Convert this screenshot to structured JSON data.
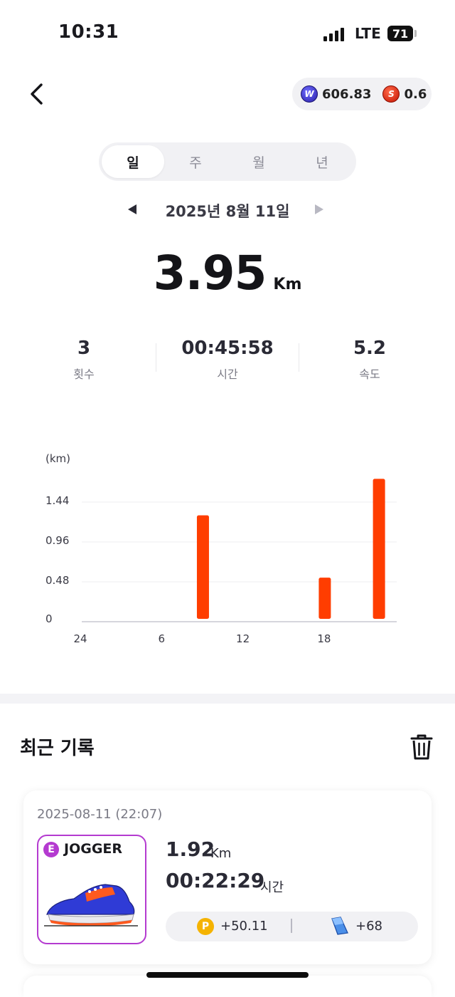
{
  "status_bar": {
    "time": "10:31",
    "network": "LTE",
    "battery": "71"
  },
  "header": {
    "tokens": [
      {
        "icon": "w-coin-icon",
        "symbol": "W",
        "value": "606.83"
      },
      {
        "icon": "s-coin-icon",
        "symbol": "S",
        "value": "0.6"
      }
    ]
  },
  "tabs": [
    {
      "label": "일",
      "active": true
    },
    {
      "label": "주",
      "active": false
    },
    {
      "label": "월",
      "active": false
    },
    {
      "label": "년",
      "active": false
    }
  ],
  "date_nav": {
    "label": "2025년 8월 11일"
  },
  "summary": {
    "distance": "3.95",
    "unit": "Km",
    "stats": [
      {
        "value": "3",
        "label": "횟수"
      },
      {
        "value": "00:45:58",
        "label": "시간"
      },
      {
        "value": "5.2",
        "label": "속도"
      }
    ]
  },
  "chart_data": {
    "type": "bar",
    "ylabel": "(km)",
    "x_ticks": [
      "24",
      "6",
      "12",
      "18"
    ],
    "y_ticks": [
      "1.44",
      "0.96",
      "0.48",
      "0"
    ],
    "ylim": [
      0,
      1.44
    ],
    "bars": [
      {
        "hour": 9,
        "value": 1.28
      },
      {
        "hour": 18,
        "value": 0.53
      },
      {
        "hour": 22,
        "value": 1.72
      }
    ],
    "color": "#ff3d00"
  },
  "recent": {
    "title": "최근 기록",
    "records": [
      {
        "datetime": "2025-08-11 (22:07)",
        "badge": "E",
        "grade": "JOGGER",
        "distance": "1.92",
        "distance_unit": "Km",
        "time": "00:22:29",
        "time_unit": "시간",
        "reward_points": "+50.11",
        "reward_tiles": "+68"
      }
    ]
  },
  "colors": {
    "accent": "#ff3d00",
    "grade": "#b43ad0",
    "point": "#f5b300"
  }
}
